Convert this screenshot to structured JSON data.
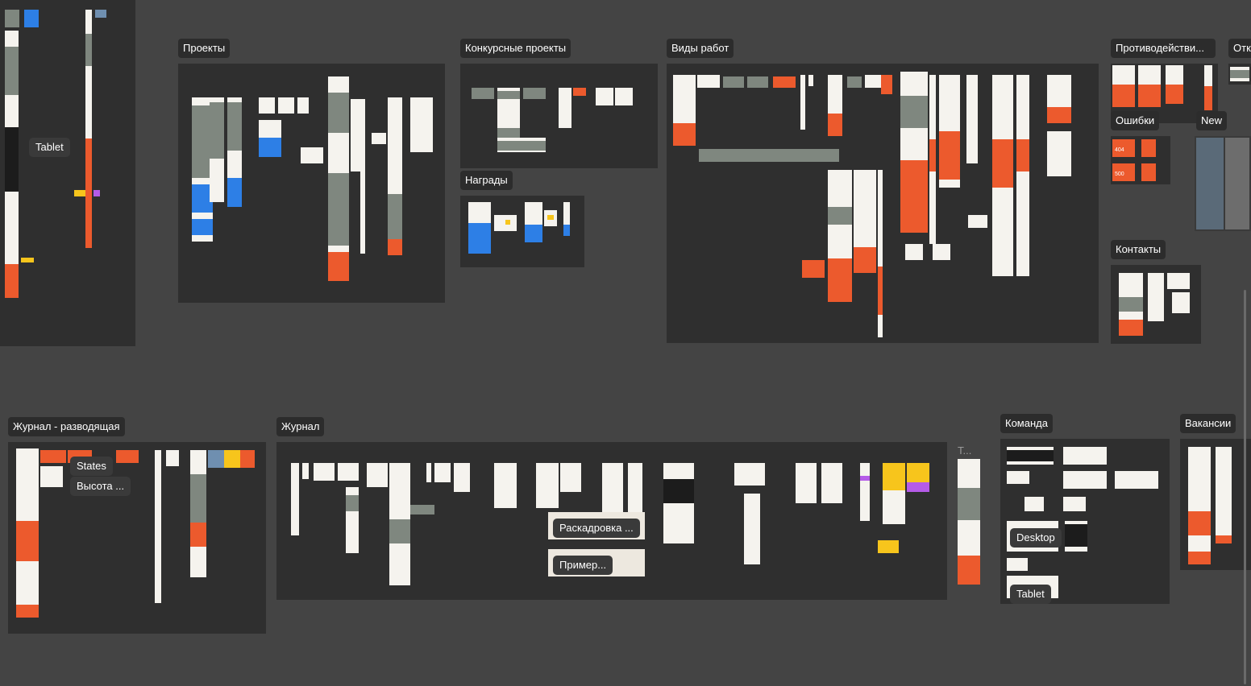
{
  "canvas": {
    "background": "#444444",
    "section_fill": "#2f2f2f",
    "accent_orange": "#ec5a2d",
    "accent_blue": "#2d7fe6",
    "accent_yellow": "#f7c51c",
    "accent_purple": "#b55be8"
  },
  "sections": {
    "projects": "Проекты",
    "contest_projects": "Конкурсные проекты",
    "awards": "Награды",
    "work_types": "Виды работ",
    "counteraction": "Противодействи...",
    "partial_right": "Отк",
    "errors": "Ошибки",
    "new": "New",
    "contacts": "Контакты",
    "journal_hub": "Журнал - разводящая",
    "journal": "Журнал",
    "journal_side": "Т...",
    "team": "Команда",
    "vacancies": "Вакансии"
  },
  "chips": {
    "tablet_top": "Tablet",
    "states": "States",
    "height": "Высота ...",
    "storyboard": "Раскадровка ...",
    "example": "Пример...",
    "desktop": "Desktop",
    "tablet_team": "Tablet"
  },
  "error_codes": [
    "404",
    "500"
  ]
}
